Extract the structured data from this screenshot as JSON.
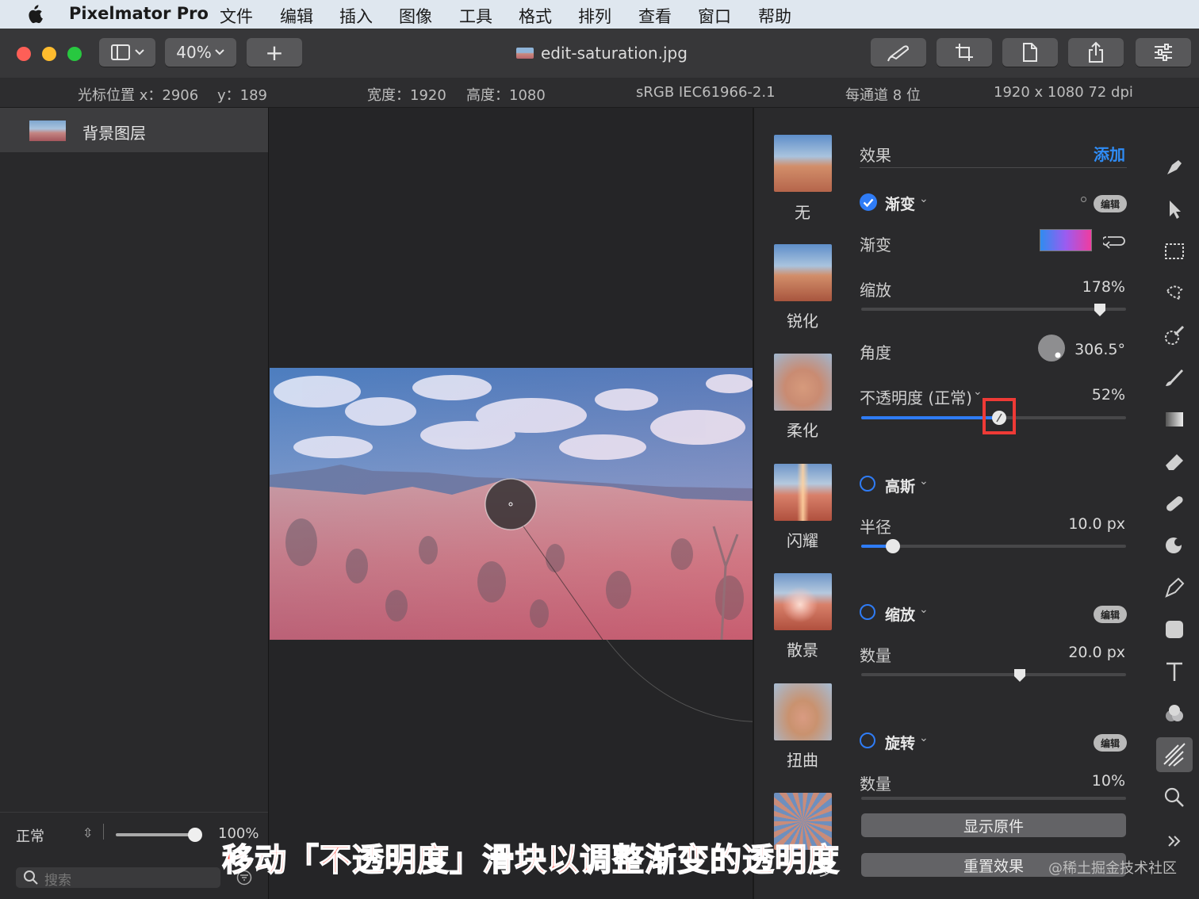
{
  "menubar": {
    "app_name": "Pixelmator Pro",
    "items": [
      "文件",
      "编辑",
      "插入",
      "图像",
      "工具",
      "格式",
      "排列",
      "查看",
      "窗口",
      "帮助"
    ]
  },
  "toolbar": {
    "zoom": "40%",
    "add_label": "+",
    "document_title": "edit-saturation.jpg"
  },
  "infobar": {
    "cursor_x": "光标位置 x：2906",
    "cursor_y": "y：189",
    "width": "宽度：1920",
    "height": "高度：1080",
    "color_profile": "sRGB IEC61966-2.1",
    "bit_depth": "每通道 8 位",
    "resolution": "1920 x 1080 72 dpi"
  },
  "layers": {
    "layer_name": "背景图层",
    "blend_mode": "正常",
    "opacity": "100%",
    "search_placeholder": "搜索"
  },
  "effects_browser": [
    "无",
    "锐化",
    "柔化",
    "闪耀",
    "散景",
    "扭曲",
    "罗"
  ],
  "panel": {
    "header": "效果",
    "add_label": "添加",
    "gradient": {
      "name": "渐变",
      "enabled": true,
      "edit": "编辑",
      "gradient_label": "渐变",
      "scale_label": "缩放",
      "scale_value": "178%",
      "scale_level": 0.9,
      "angle_label": "角度",
      "angle_value": "306.5°",
      "opacity_label": "不透明度 (正常)",
      "opacity_value": "52%",
      "opacity_level": 0.52,
      "colors": [
        "#2f8cf0",
        "#9b5cf0",
        "#f03ca0"
      ]
    },
    "gaussian": {
      "name": "高斯",
      "enabled": false,
      "radius_label": "半径",
      "radius_value": "10.0 px",
      "radius_level": 0.12
    },
    "zoom": {
      "name": "缩放",
      "enabled": false,
      "edit": "编辑",
      "amount_label": "数量",
      "amount_value": "20.0 px",
      "amount_level": 0.6
    },
    "spin": {
      "name": "旋转",
      "enabled": false,
      "edit": "编辑",
      "amount_label": "数量",
      "amount_value": "10%"
    },
    "show_original": "显示原件",
    "reset_effects": "重置效果"
  },
  "caption": "移动「不透明度」滑块以调整渐变的透明度",
  "watermark": "@稀土掘金技术社区",
  "accent_color": "#2f7cf6"
}
